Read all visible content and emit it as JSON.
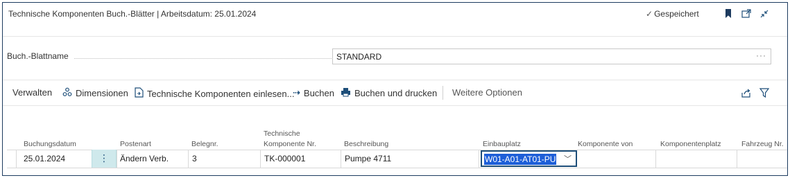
{
  "titlebar": {
    "title": "Technische Komponenten Buch.-Blätter | Arbeitsdatum: 25.01.2024",
    "saved": "Gespeichert",
    "icons": [
      "bookmark-icon",
      "popout-icon",
      "collapse-icon"
    ]
  },
  "field": {
    "label": "Buch.-Blattname",
    "value": "STANDARD",
    "more": "···"
  },
  "actions": {
    "manage": "Verwalten",
    "dimensions": "Dimensionen",
    "import": "Technische Komponenten einlesen...",
    "post": "Buchen",
    "post_print": "Buchen und drucken",
    "more_options": "Weitere Optionen"
  },
  "grid": {
    "headers": {
      "posting_date": "Buchungsdatum",
      "entry_type": "Postenart",
      "doc_no": "Belegnr.",
      "component_no_1": "Technische",
      "component_no_2": "Komponente Nr.",
      "description": "Beschreibung",
      "install_place": "Einbauplatz",
      "component_of": "Komponente von",
      "component_place": "Komponentenplatz",
      "vehicle_no": "Fahrzeug Nr."
    },
    "rows": [
      {
        "posting_date": "25.01.2024",
        "entry_type": "Ändern Verb.",
        "doc_no": "3",
        "component_no": "TK-000001",
        "description": "Pumpe 4711",
        "install_place": "W01-A01-AT01-PU",
        "component_of": "",
        "component_place": "",
        "vehicle_no": ""
      }
    ]
  }
}
